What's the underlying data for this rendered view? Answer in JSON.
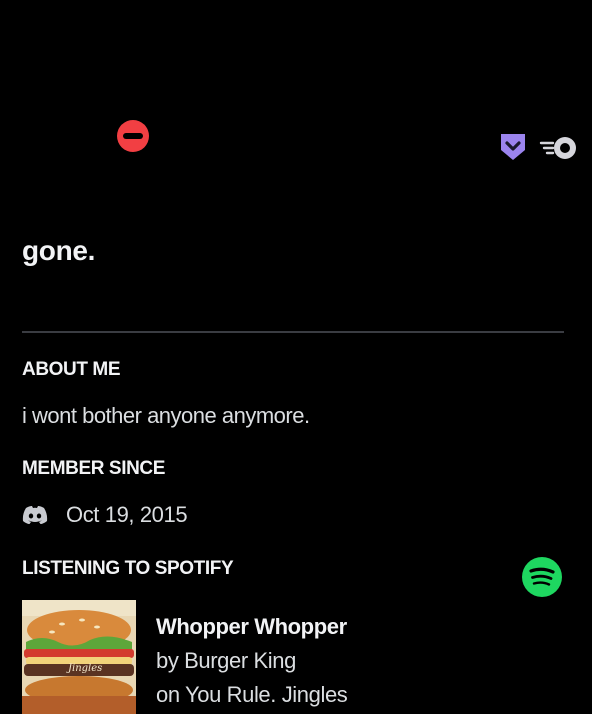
{
  "profile": {
    "status": "do-not-disturb",
    "status_icon": "dnd-icon",
    "badges": [
      "hypesquad-badge-icon",
      "nitro-badge-icon"
    ],
    "display_name": "gone."
  },
  "about": {
    "heading": "ABOUT ME",
    "text": "i wont bother anyone anymore."
  },
  "member_since": {
    "heading": "MEMBER SINCE",
    "icon": "discord-icon",
    "date": "Oct 19, 2015"
  },
  "spotify": {
    "heading": "LISTENING TO SPOTIFY",
    "icon": "spotify-icon",
    "album_art_text": "Jingles",
    "track": "Whopper Whopper",
    "artist_line": "by Burger King",
    "album_line": "on You Rule. Jingles"
  },
  "colors": {
    "background": "#000000",
    "dnd": "#f23f43",
    "hypesquad": "#9b84ee",
    "spotify": "#1ed760",
    "divider": "#3a3c42"
  }
}
